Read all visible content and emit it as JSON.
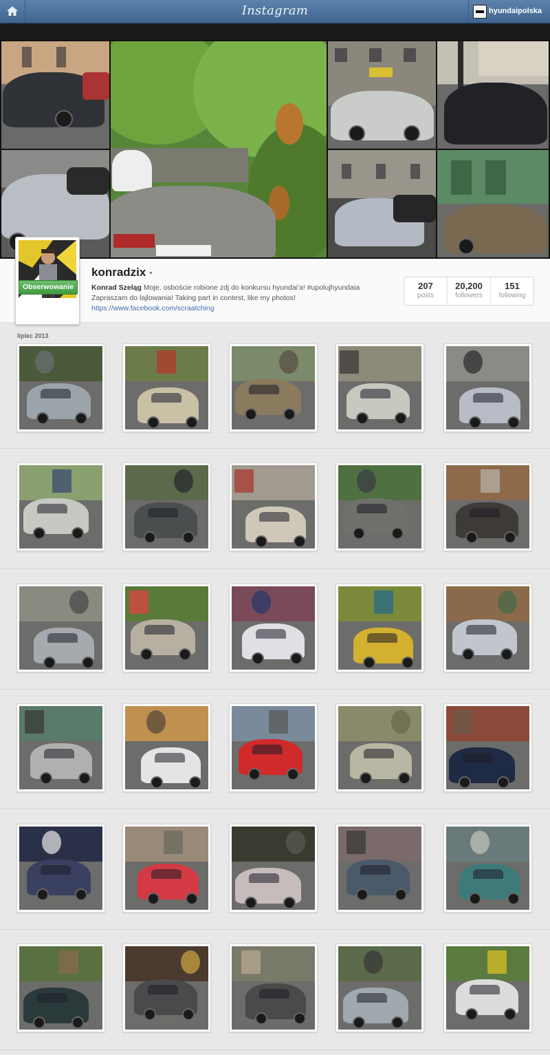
{
  "topbar": {
    "logo": "Instagram",
    "username": "hyundaipolska"
  },
  "profile": {
    "username": "konradzix",
    "full_name": "Konrad Szeląg",
    "bio_line1": "Moje, osboście robione zdj do konkursu hyundai'a! #upolujhyundaia",
    "bio_line2": "Zapraszam do lajlowania! Taking part in contest, like my photos!",
    "link": "https://www.facebook.com/scraatching",
    "follow_label": "Obserwowanie",
    "stats": [
      {
        "num": "207",
        "label": "posts"
      },
      {
        "num": "20,200",
        "label": "followers"
      },
      {
        "num": "151",
        "label": "following"
      }
    ]
  },
  "grid": {
    "month": "lipiec 2013"
  },
  "photo_palettes": [
    [
      "#4a5a3a",
      "#9aa4aa",
      "#6b6e70"
    ],
    [
      "#6b7c4a",
      "#c9c1a6",
      "#b33a2c"
    ],
    [
      "#7a8a6a",
      "#8a7a5e",
      "#5b4f43"
    ],
    [
      "#8e8a7a",
      "#c8c8c0",
      "#3a3a3a"
    ],
    [
      "#8c8a84",
      "#b7bcc6",
      "#2e2e32"
    ],
    [
      "#8aa070",
      "#c5c9c2",
      "#3a4b6e"
    ],
    [
      "#5a6a4a",
      "#4a4e4e",
      "#2a2c2e"
    ],
    [
      "#a09a90",
      "#cfc8b8",
      "#a83a30"
    ],
    [
      "#4f7040",
      "#70706a",
      "#3a3d44"
    ],
    [
      "#8c6a4a",
      "#3e3a38",
      "#b8b2a8"
    ],
    [
      "#8a8a80",
      "#a6a9ad",
      "#4a4a4a"
    ],
    [
      "#5a7a3a",
      "#b7b0a2",
      "#d44"
    ],
    [
      "#7a4a5a",
      "#e0e0e4",
      "#2a3a6a"
    ],
    [
      "#7a8a3a",
      "#d4b030",
      "#2a6a8a"
    ],
    [
      "#8a6a4a",
      "#c0c6cc",
      "#4a6a4a"
    ],
    [
      "#5a7a6a",
      "#b0b0ae",
      "#3a3a3a"
    ],
    [
      "#c09050",
      "#e4e4e4",
      "#5a4a3a"
    ],
    [
      "#7a8a9a",
      "#d02a2a",
      "#5a5a5a"
    ],
    [
      "#8a8a6a",
      "#b9b7a3",
      "#6a6a4a"
    ],
    [
      "#8a4a3a",
      "#1f2a44",
      "#6a5a4a"
    ],
    [
      "#2a3048",
      "#3a4060",
      "#ddd"
    ],
    [
      "#9a8a7a",
      "#d33a44",
      "#6a6a60"
    ],
    [
      "#3a3a30",
      "#c6bcbc",
      "#5a5a50"
    ],
    [
      "#7a6a6a",
      "#4a5a6a",
      "#3a3a3a"
    ],
    [
      "#6a7a7a",
      "#3f7a7a",
      "#c0c0b8"
    ],
    [
      "#5a7040",
      "#2a3a3a",
      "#8a6a4a"
    ],
    [
      "#4a3a30",
      "#4a4a4c",
      "#c8a040"
    ],
    [
      "#7a7a6a",
      "#4a4a4a",
      "#b8a890"
    ],
    [
      "#5a6a4a",
      "#a0a8b0",
      "#3a3a3a"
    ],
    [
      "#5a7a40",
      "#dcdcdc",
      "#d8c020"
    ]
  ]
}
